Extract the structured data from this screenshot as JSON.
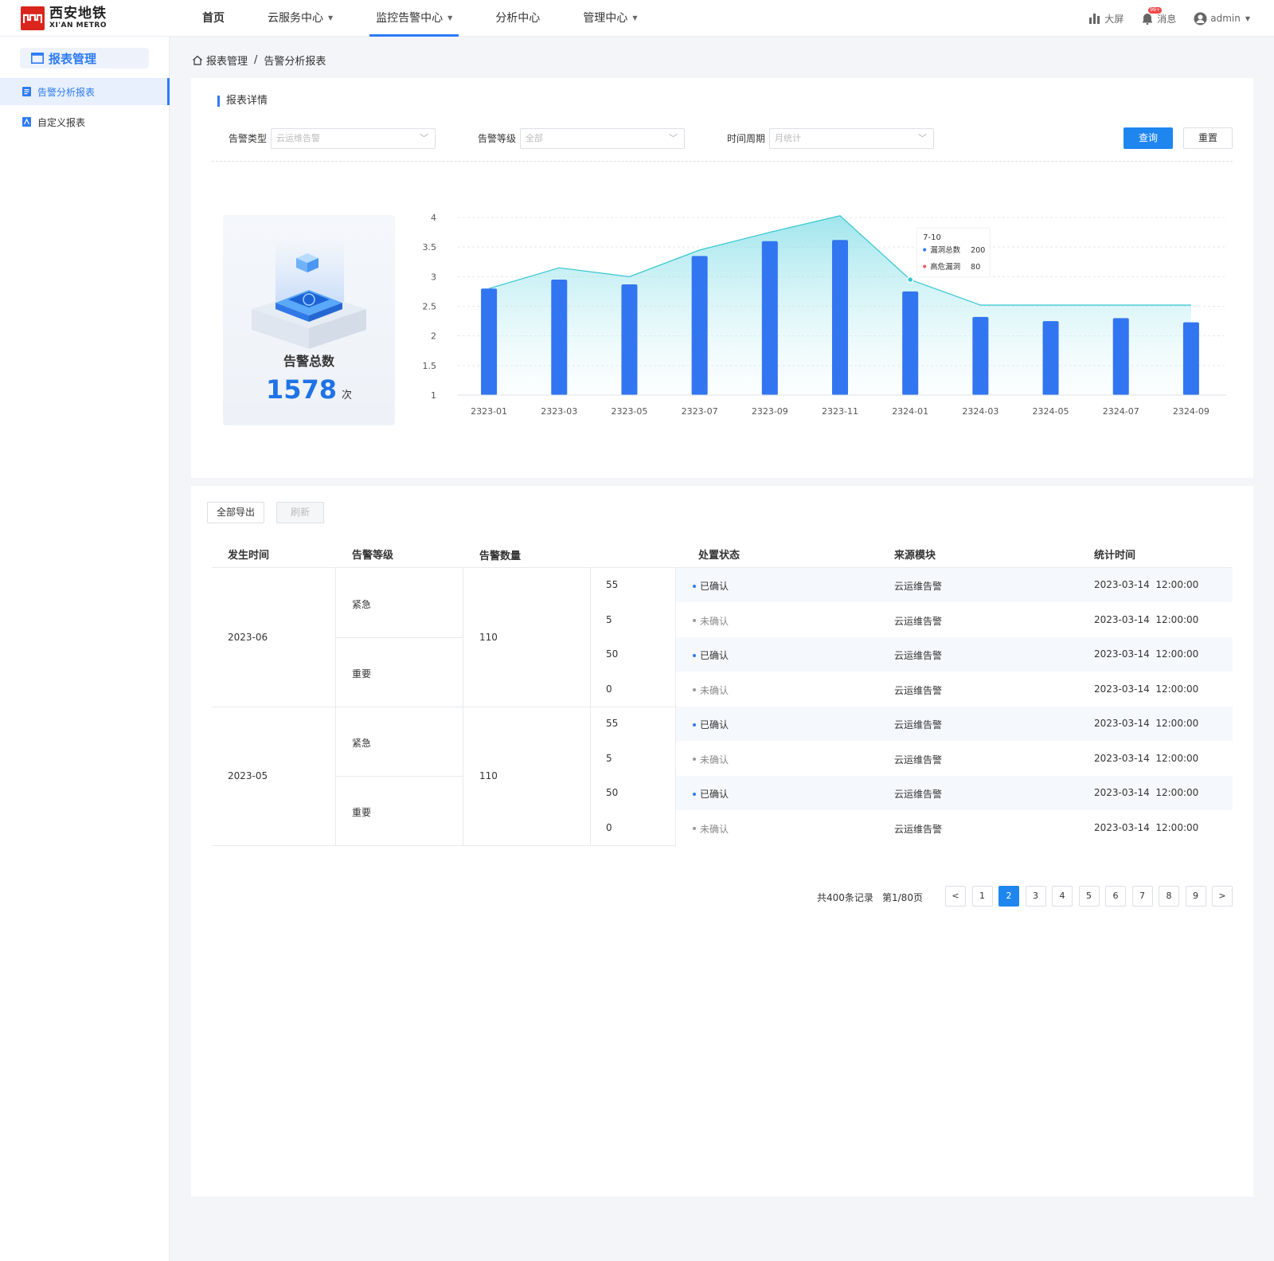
{
  "brand": {
    "name_cn": "西安地铁",
    "name_en": "XI'AN METRO",
    "color": "#d9251d"
  },
  "nav": {
    "items": [
      {
        "label": "首页",
        "has_caret": false
      },
      {
        "label": "云服务中心",
        "has_caret": true
      },
      {
        "label": "监控告警中心",
        "has_caret": true
      },
      {
        "label": "分析中心",
        "has_caret": false
      },
      {
        "label": "管理中心",
        "has_caret": true
      }
    ],
    "active_index": 2,
    "accent": "#2d7bf6"
  },
  "topright": {
    "screen": "大屏",
    "messages": "消息",
    "badge": "99+",
    "user": "admin"
  },
  "sidebar": {
    "header": "报表管理",
    "items": [
      {
        "label": "告警分析报表",
        "active": true
      },
      {
        "label": "自定义报表",
        "active": false
      }
    ]
  },
  "breadcrumb": {
    "root": "报表管理",
    "sep": "/",
    "current": "告警分析报表"
  },
  "report": {
    "section_title": "报表详情",
    "filters": [
      {
        "label": "告警类型",
        "placeholder": "云运维告警"
      },
      {
        "label": "告警等级",
        "placeholder": "全部"
      },
      {
        "label": "时间周期",
        "placeholder": "月统计"
      }
    ],
    "query_label": "查询",
    "reset_label": "重置"
  },
  "stat": {
    "title": "告警总数",
    "value": "1578",
    "unit": "次"
  },
  "chart_data": {
    "type": "bar",
    "categories": [
      "2323-01",
      "2323-03",
      "2323-05",
      "2323-07",
      "2323-09",
      "2323-11",
      "2324-01",
      "2324-03",
      "2324-05",
      "2324-07",
      "2324-09"
    ],
    "series": [
      {
        "type": "bar",
        "values": [
          2.8,
          2.95,
          2.87,
          3.35,
          3.6,
          3.62,
          2.75,
          2.32,
          2.25,
          2.3,
          2.23
        ],
        "color": "#3275f0"
      },
      {
        "type": "area",
        "values": [
          2.8,
          3.15,
          3.0,
          3.45,
          3.75,
          4.03,
          2.95,
          2.52,
          2.52,
          2.52,
          2.52
        ],
        "color": "#33c7cf"
      }
    ],
    "ylim": [
      1,
      4
    ],
    "yticks": [
      "4",
      "3.5",
      "3",
      "2.5",
      "2",
      "1.5",
      "1"
    ],
    "grid": "horizontal-dashed",
    "tooltip": {
      "title": "7-10",
      "rows": [
        {
          "name": "漏洞总数",
          "value": "200",
          "color": "#3275f0"
        },
        {
          "name": "高危漏洞",
          "value": "80",
          "color": "#f05a5a"
        }
      ]
    }
  },
  "table": {
    "export_label": "全部导出",
    "refresh_label": "刷新",
    "columns": [
      "发生时间",
      "告警等级",
      "告警数量",
      "处置状态",
      "来源模块",
      "统计时间"
    ],
    "groups": [
      {
        "time": "2023-06",
        "total": "110",
        "levels": [
          "紧急",
          "重要"
        ],
        "rows": [
          {
            "count": "55",
            "status": "已确认",
            "source": "云运维告警",
            "stat_time": "2023-03-14  12:00:00"
          },
          {
            "count": "5",
            "status": "未确认",
            "source": "云运维告警",
            "stat_time": "2023-03-14  12:00:00"
          },
          {
            "count": "50",
            "status": "已确认",
            "source": "云运维告警",
            "stat_time": "2023-03-14  12:00:00"
          },
          {
            "count": "0",
            "status": "未确认",
            "source": "云运维告警",
            "stat_time": "2023-03-14  12:00:00"
          }
        ]
      },
      {
        "time": "2023-05",
        "total": "110",
        "levels": [
          "紧急",
          "重要"
        ],
        "rows": [
          {
            "count": "55",
            "status": "已确认",
            "source": "云运维告警",
            "stat_time": "2023-03-14  12:00:00"
          },
          {
            "count": "5",
            "status": "未确认",
            "source": "云运维告警",
            "stat_time": "2023-03-14  12:00:00"
          },
          {
            "count": "50",
            "status": "已确认",
            "source": "云运维告警",
            "stat_time": "2023-03-14  12:00:00"
          },
          {
            "count": "0",
            "status": "未确认",
            "source": "云运维告警",
            "stat_time": "2023-03-14  12:00:00"
          }
        ]
      }
    ],
    "status_colors": {
      "confirmed": "#2d7bf6",
      "unconfirmed": "#999999"
    }
  },
  "pagination": {
    "total_text": "共400条记录",
    "page_text": "第1/80页",
    "pages": [
      "1",
      "2",
      "3",
      "4",
      "5",
      "6",
      "7",
      "8",
      "9"
    ],
    "active": "2",
    "prev": "<",
    "next": ">"
  }
}
